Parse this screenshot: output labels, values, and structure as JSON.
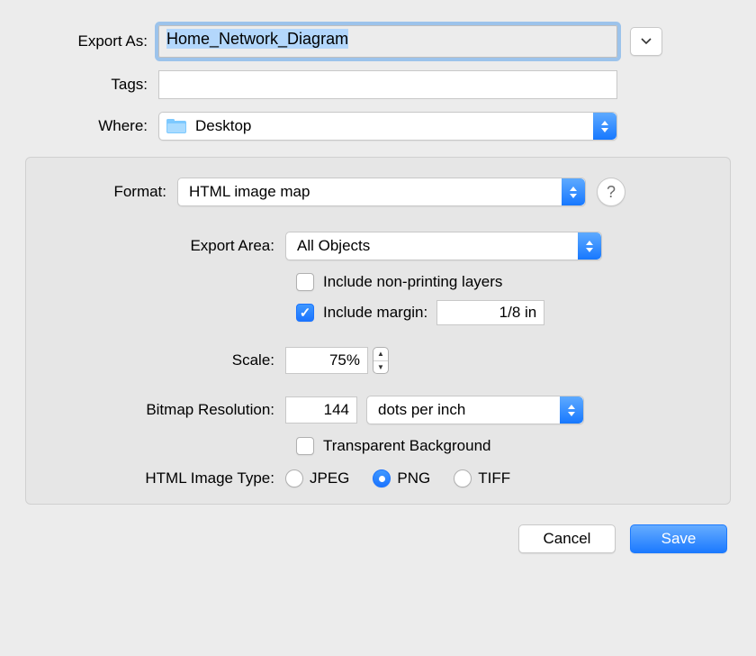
{
  "labels": {
    "export_as": "Export As:",
    "tags": "Tags:",
    "where": "Where:",
    "format": "Format:",
    "export_area": "Export Area:",
    "include_nonprinting": "Include non-printing layers",
    "include_margin": "Include margin:",
    "scale": "Scale:",
    "bitmap_resolution": "Bitmap Resolution:",
    "transparent_bg": "Transparent Background",
    "html_image_type": "HTML Image Type:"
  },
  "values": {
    "filename": "Home_Network_Diagram",
    "where": "Desktop",
    "format": "HTML image map",
    "export_area": "All Objects",
    "margin": "1/8 in",
    "scale": "75%",
    "resolution": "144",
    "resolution_unit": "dots per inch"
  },
  "radio": {
    "jpeg": "JPEG",
    "png": "PNG",
    "tiff": "TIFF"
  },
  "buttons": {
    "cancel": "Cancel",
    "save": "Save",
    "help": "?"
  }
}
